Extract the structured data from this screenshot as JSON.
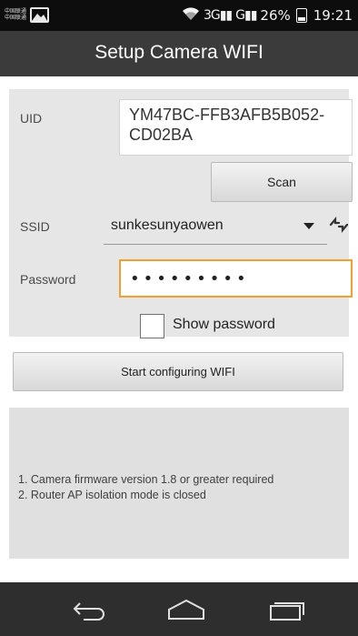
{
  "status_bar": {
    "carrier_line1": "中国联通",
    "carrier_line2": "中国联通",
    "network_1": "3G",
    "network_2": "G",
    "battery": "26%",
    "time": "19:21",
    "icons": [
      "image-notification-icon",
      "wifi-icon",
      "signal-icon",
      "battery-icon"
    ]
  },
  "header": {
    "title": "Setup Camera WIFI"
  },
  "form": {
    "uid_label": "UID",
    "uid_value": "YM47BC-FFB3AFB5B052-CD02BA",
    "scan_label": "Scan",
    "ssid_label": "SSID",
    "ssid_value": "sunkesunyaowen",
    "password_label": "Password",
    "password_value": "•••••••••",
    "show_password_label": "Show password",
    "show_password_checked": false
  },
  "actions": {
    "start_label": "Start configuring WIFI"
  },
  "notes": [
    "1. Camera firmware version 1.8 or greater required",
    "2. Router AP isolation mode is closed"
  ],
  "nav_bar": {
    "icons": [
      "back-icon",
      "home-icon",
      "recent-apps-icon"
    ]
  },
  "colors": {
    "title_bar": "#3b3b3b",
    "status_bar": "#0d0d0d",
    "panel": "#e6e6e6",
    "focus_border": "#f2a12e",
    "nav_bar": "#2e2e2e"
  }
}
